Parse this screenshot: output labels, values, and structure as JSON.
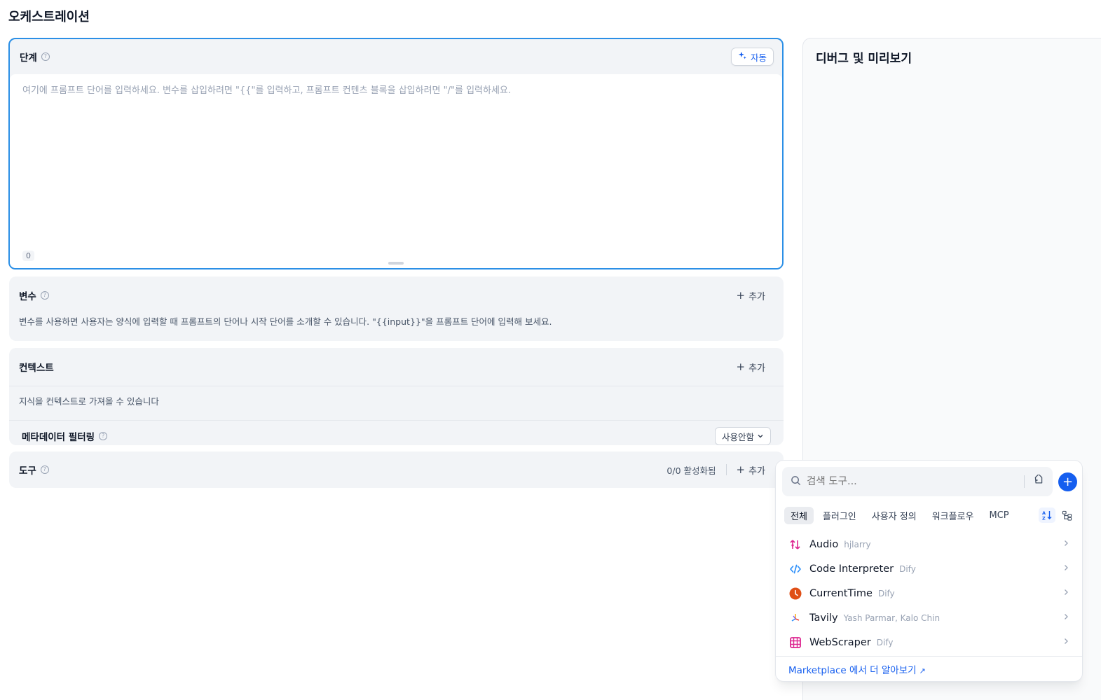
{
  "page": {
    "title": "오케스트레이션"
  },
  "prompt": {
    "title": "단계",
    "auto_label": "자동",
    "placeholder": "여기에 프롬프트 단어를 입력하세요. 변수를 삽입하려면 \"{{\"를 입력하고, 프롬프트 컨텐츠 블록을 삽입하려면 \"/\"를 입력하세요.",
    "char_count": "0"
  },
  "variables": {
    "title": "변수",
    "add_label": "추가",
    "description": "변수를 사용하면 사용자는 양식에 입력할 때 프롬프트의 단어나 시작 단어를 소개할 수 있습니다. \"{{input}}\"을 프롬프트 단어에 입력해 보세요."
  },
  "context": {
    "title": "컨텍스트",
    "add_label": "추가",
    "description": "지식을 컨텍스트로 가져올 수 있습니다",
    "metadata_filter_label": "메타데이터 필터링",
    "metadata_filter_value": "사용안함"
  },
  "tools": {
    "title": "도구",
    "count_label": "0/0 활성화됨",
    "add_label": "추가"
  },
  "debug": {
    "title": "디버그 및 미리보기"
  },
  "tool_popup": {
    "search_placeholder": "검색 도구...",
    "tabs": [
      "전체",
      "플러그인",
      "사용자 정의",
      "워크플로우",
      "MCP"
    ],
    "active_tab": "전체",
    "items": [
      {
        "name": "Audio",
        "author": "hjlarry",
        "icon": "audio-icon",
        "color": "#dd2590"
      },
      {
        "name": "Code Interpreter",
        "author": "Dify",
        "icon": "code-icon",
        "color": "#2e90fa"
      },
      {
        "name": "CurrentTime",
        "author": "Dify",
        "icon": "clock-icon",
        "color": "#e04f16"
      },
      {
        "name": "Tavily",
        "author": "Yash Parmar, Kalo Chin",
        "icon": "tavily-icon",
        "color": "#f04438"
      },
      {
        "name": "WebScraper",
        "author": "Dify",
        "icon": "webscraper-icon",
        "color": "#dd2590"
      }
    ],
    "footer_link": "Marketplace 에서 더 알아보기"
  },
  "colors": {
    "accent": "#155eef",
    "border_focus": "#2b8fe6"
  }
}
